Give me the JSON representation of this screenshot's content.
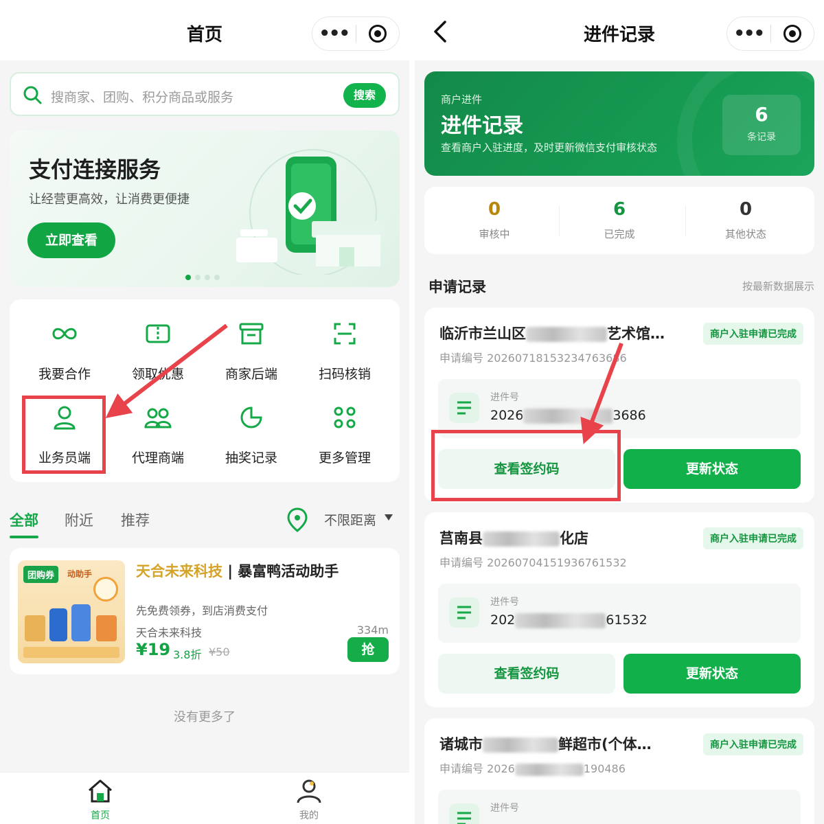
{
  "left": {
    "nav_title": "首页",
    "capsule_more": "•••",
    "search": {
      "placeholder": "搜商家、团购、积分商品或服务",
      "button": "搜索"
    },
    "banner": {
      "title": "支付连接服务",
      "subtitle": "让经营更高效，让消费更便捷",
      "cta": "立即查看"
    },
    "grid": [
      {
        "label": "我要合作",
        "icon": "handshake-icon"
      },
      {
        "label": "领取优惠",
        "icon": "coupon-icon"
      },
      {
        "label": "商家后端",
        "icon": "store-icon"
      },
      {
        "label": "扫码核销",
        "icon": "scan-icon"
      },
      {
        "label": "业务员端",
        "icon": "person-icon"
      },
      {
        "label": "代理商端",
        "icon": "group-icon"
      },
      {
        "label": "抽奖记录",
        "icon": "pie-icon"
      },
      {
        "label": "更多管理",
        "icon": "apps-icon"
      }
    ],
    "tabs": [
      "全部",
      "附近",
      "推荐"
    ],
    "distance_filter": "不限距离",
    "deal": {
      "thumb_tag": "团购券",
      "thumb_tag2": "动助手",
      "name_a": "天合未来科技",
      "name_sep": "|",
      "name_b": "暴富鸭活动助手",
      "desc": "先免费领券，到店消费支付",
      "shop": "天合未来科技",
      "distance": "334m",
      "price": "¥19",
      "discount": "3.8折",
      "orig_price": "¥50",
      "grab": "抢"
    },
    "no_more": "没有更多了",
    "tabbar": [
      {
        "label": "首页",
        "icon": "home-icon",
        "active": true
      },
      {
        "label": "我的",
        "icon": "user-icon",
        "active": false
      }
    ]
  },
  "right": {
    "nav_title": "进件记录",
    "capsule_more": "•••",
    "header": {
      "kicker": "商户进件",
      "title": "进件记录",
      "desc": "查看商户入驻进度，及时更新微信支付审核状态",
      "count": "6",
      "count_unit": "条记录"
    },
    "stats": [
      {
        "value": "0",
        "label": "审核中",
        "color": "#b7860b"
      },
      {
        "value": "6",
        "label": "已完成",
        "color": "#14953f"
      },
      {
        "value": "0",
        "label": "其他状态",
        "color": "#333333"
      }
    ],
    "section_title": "申请记录",
    "section_note": "按最新数据展示",
    "records": [
      {
        "name_a": "临沂市兰山区",
        "name_b": "艺术馆…",
        "badge": "商户入驻申请已完成",
        "app_label": "申请编号",
        "app_no": "202607181532347636",
        "app_no_tail": "86",
        "doc_label": "进件号",
        "doc_a": "2026",
        "doc_b": "3686",
        "btn_view": "查看签约码",
        "btn_update": "更新状态"
      },
      {
        "name_a": "莒南县",
        "name_b": "化店",
        "badge": "商户入驻申请已完成",
        "app_label": "申请编号",
        "app_no": "20260704151936761532",
        "app_no_tail": "",
        "doc_label": "进件号",
        "doc_a": "202",
        "doc_b": "61532",
        "btn_view": "查看签约码",
        "btn_update": "更新状态"
      },
      {
        "name_a": "诸城市",
        "name_b": "鲜超市(个体…",
        "badge": "商户入驻申请已完成",
        "app_label": "申请编号",
        "app_no": "2026",
        "app_no_tail": "190486",
        "doc_label": "进件号",
        "doc_a": "",
        "doc_b": "",
        "btn_view": "",
        "btn_update": ""
      }
    ]
  },
  "colors": {
    "brand_green": "#12b24c",
    "dark_green": "#138a48",
    "highlight_red": "#e8424a",
    "gold": "#d4a327"
  }
}
